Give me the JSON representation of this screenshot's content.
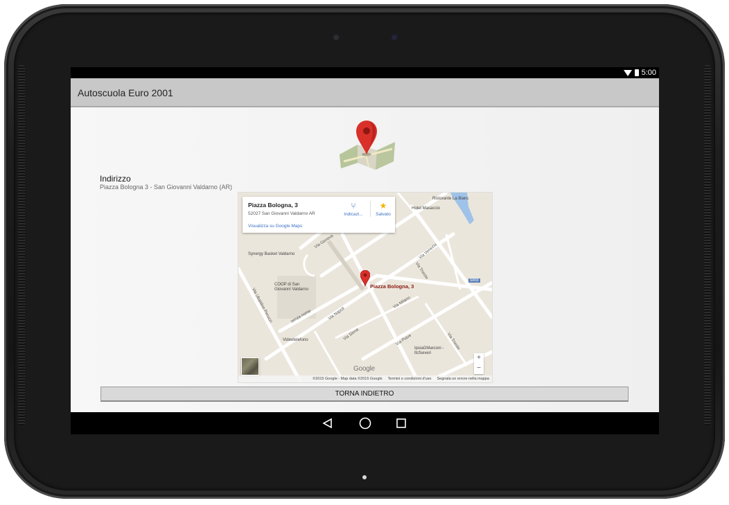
{
  "status_bar": {
    "time": "5:00",
    "wifi_icon": "wifi-icon",
    "battery_icon": "battery-icon"
  },
  "action_bar": {
    "title": "Autoscuola Euro 2001"
  },
  "logo": {
    "icon": "map-marker-icon",
    "pin_color": "#d9302a"
  },
  "address": {
    "label": "Indirizzo",
    "value": "Piazza Bologna 3 - San Giovanni Valdarno (AR)"
  },
  "map": {
    "card": {
      "name": "Piazza Bologna, 3",
      "address": "52027 San Giovanni Valdarno AR",
      "link": "Visualizza su Google Maps",
      "directions_label": "Indicazi...",
      "saved_label": "Salvato"
    },
    "pin_label": "Piazza Bologna, 3",
    "streets": [
      "Via Genova",
      "Via Venezia",
      "Via Trieste",
      "Via Piave",
      "Via Milano",
      "Via Napoli",
      "Via Siena",
      "Via Ubaldino Peruzzi",
      "senza nome",
      "Via Trieste"
    ],
    "pois": [
      "Ristorante La Bianc",
      "Hotel Masaccio",
      "Synergy Basket Valdarno",
      "COOP di San Giovanni Valdarno",
      "Videotelefono",
      "IpsiaGMarconi - Itcfseveri",
      "SR69"
    ],
    "zoom_in": "+",
    "zoom_out": "−",
    "brand": "Google",
    "footer": [
      "©2015 Google - Map data ©2015 Google",
      "Termini e condizioni d'uso",
      "Segnala un errore nella mappa"
    ]
  },
  "back_button": {
    "label": "TORNA INDIETRO"
  },
  "nav_bar": {
    "back_icon": "back-triangle-icon",
    "home_icon": "home-circle-icon",
    "recents_icon": "recents-square-icon"
  }
}
